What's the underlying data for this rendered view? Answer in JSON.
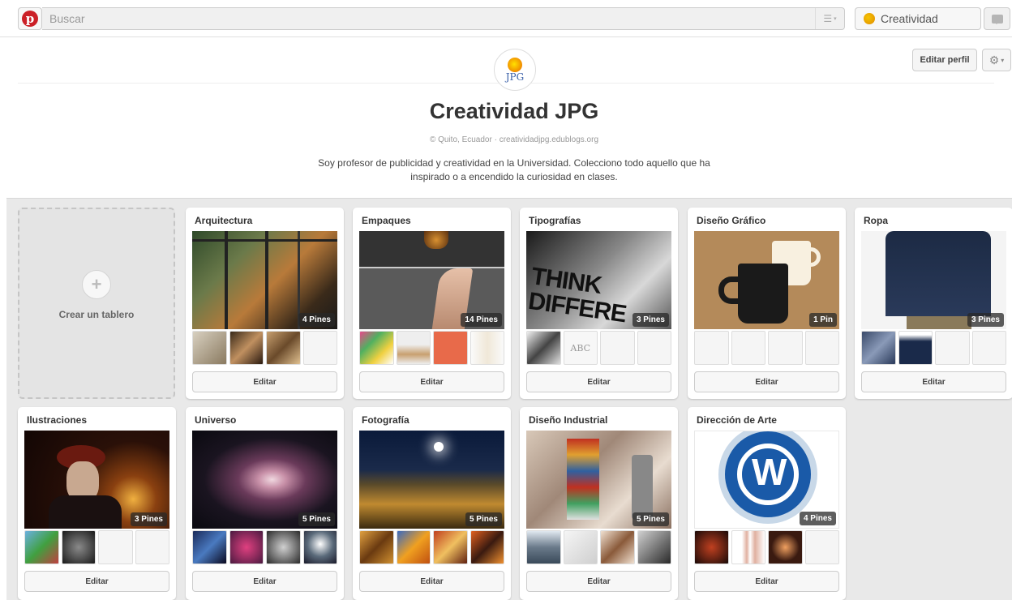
{
  "topbar": {
    "search_placeholder": "Buscar",
    "user_label": "Creatividad",
    "logo_letter": "p"
  },
  "profile": {
    "avatar_text": "JPG",
    "edit_label": "Editar perfil",
    "name": "Creatividad JPG",
    "meta": "© Quito, Ecuador · creatividadjpg.edublogs.org",
    "bio": "Soy profesor de publicidad y creatividad en la Universidad. Colecciono todo aquello que ha inspirado o a encendido la curiosidad en clases."
  },
  "create_board_label": "Crear un tablero",
  "edit_label": "Editar",
  "boards": [
    {
      "title": "Arquitectura",
      "count": "4 Pines"
    },
    {
      "title": "Empaques",
      "count": "14 Pines"
    },
    {
      "title": "Tipografías",
      "count": "3 Pines"
    },
    {
      "title": "Diseño Gráfico",
      "count": "1 Pin"
    },
    {
      "title": "Ropa",
      "count": "3 Pines"
    },
    {
      "title": "Ilustraciones",
      "count": "3 Pines"
    },
    {
      "title": "Universo",
      "count": "5 Pines"
    },
    {
      "title": "Fotografía",
      "count": "5 Pines"
    },
    {
      "title": "Diseño Industrial",
      "count": "5 Pines"
    },
    {
      "title": "Dirección de Arte",
      "count": "4 Pines"
    }
  ],
  "colors": {
    "brand_red": "#cb2027",
    "board_bg": "#e9e9e9"
  }
}
